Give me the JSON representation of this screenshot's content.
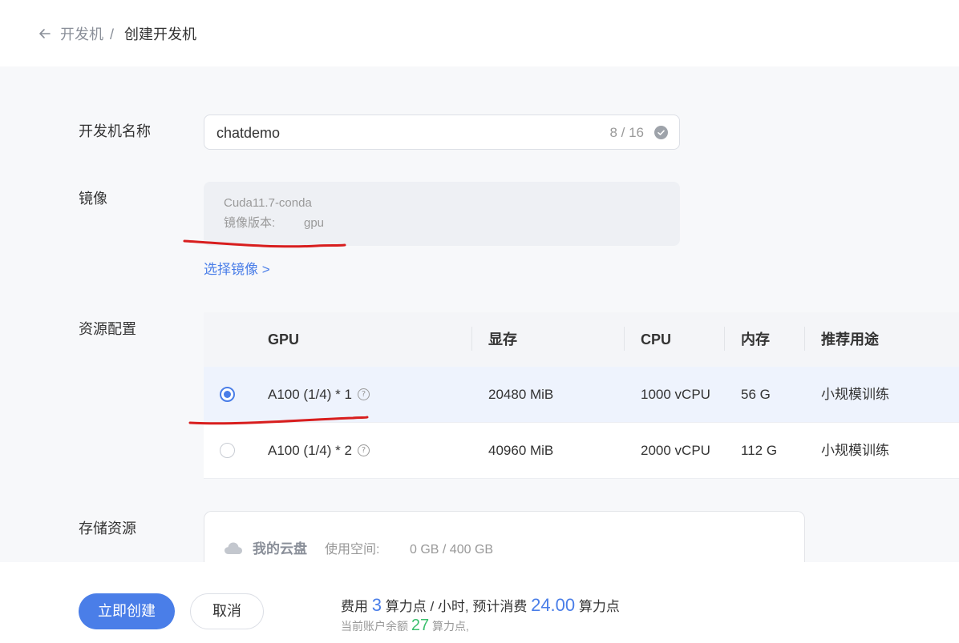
{
  "breadcrumb": {
    "parent": "开发机",
    "separator": "/",
    "current": "创建开发机"
  },
  "form": {
    "name": {
      "label": "开发机名称",
      "value": "chatdemo",
      "count": "8 / 16"
    },
    "image": {
      "label": "镜像",
      "name": "Cuda11.7-conda",
      "version_label": "镜像版本:",
      "version_value": "gpu",
      "select_link": "选择镜像 >"
    },
    "resource": {
      "label": "资源配置",
      "columns": [
        "GPU",
        "显存",
        "CPU",
        "内存",
        "推荐用途"
      ],
      "rows": [
        {
          "gpu": "A100 (1/4) * 1",
          "vram": "20480 MiB",
          "cpu": "1000 vCPU",
          "mem": "56 G",
          "usage": "小规模训练",
          "selected": true
        },
        {
          "gpu": "A100 (1/4) * 2",
          "vram": "40960 MiB",
          "cpu": "2000 vCPU",
          "mem": "112 G",
          "usage": "小规模训练",
          "selected": false
        }
      ]
    },
    "storage": {
      "label": "存储资源",
      "title": "我的云盘",
      "usage_label": "使用空间:",
      "usage_value": "0 GB / 400 GB"
    }
  },
  "footer": {
    "create_button": "立即创建",
    "cancel_button": "取消",
    "fee_prefix": "费用",
    "fee_rate": "3",
    "fee_unit": "算力点 / 小时, 预计消费",
    "fee_total": "24.00",
    "fee_total_unit": "算力点",
    "balance_prefix": "当前账户余额",
    "balance_value": "27",
    "balance_unit": "算力点,"
  },
  "colors": {
    "accent": "#4a7ee8",
    "balance": "#3cbf6e",
    "annotation": "#d81e1e"
  }
}
